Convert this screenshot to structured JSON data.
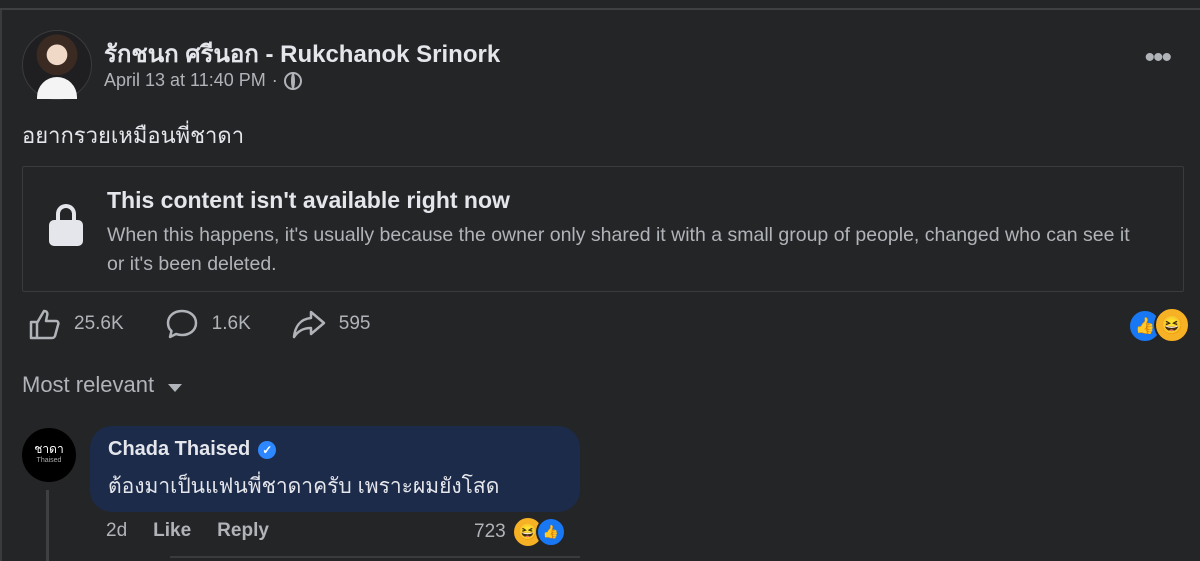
{
  "post": {
    "author": "รักชนก ศรีนอก - Rukchanok Srinork",
    "timestamp": "April 13 at 11:40 PM",
    "separator": "·",
    "privacy_icon": "globe-icon",
    "more_icon": "more-horiz-icon",
    "text": "อยากรวยเหมือนพี่ชาดา"
  },
  "unavailable": {
    "icon": "lock-icon",
    "title": "This content isn't available right now",
    "body": "When this happens, it's usually because the owner only shared it with a small group of people, changed who can see it or it's been deleted."
  },
  "stats": {
    "likes": "25.6K",
    "comments": "1.6K",
    "shares": "595",
    "reaction_icons": [
      "like-icon",
      "haha-icon"
    ]
  },
  "sort": {
    "label": "Most relevant"
  },
  "comment": {
    "avatar_text": "ชาดา",
    "avatar_subtext": "Thaised",
    "name": "Chada Thaised",
    "verified_icon": "verified-badge-icon",
    "text": "ต้องมาเป็นแฟนพี่ชาดาครับ เพราะผมยังโสด",
    "age": "2d",
    "like_label": "Like",
    "reply_label": "Reply",
    "reaction_count": "723",
    "reaction_icons": [
      "haha-icon",
      "like-icon"
    ]
  },
  "colors": {
    "background": "#242526",
    "bubble": "#1c2b4a",
    "accent_blue": "#1877f2",
    "haha_yellow": "#f7b125",
    "secondary_text": "#b0b3b8",
    "primary_text": "#e4e6eb"
  }
}
